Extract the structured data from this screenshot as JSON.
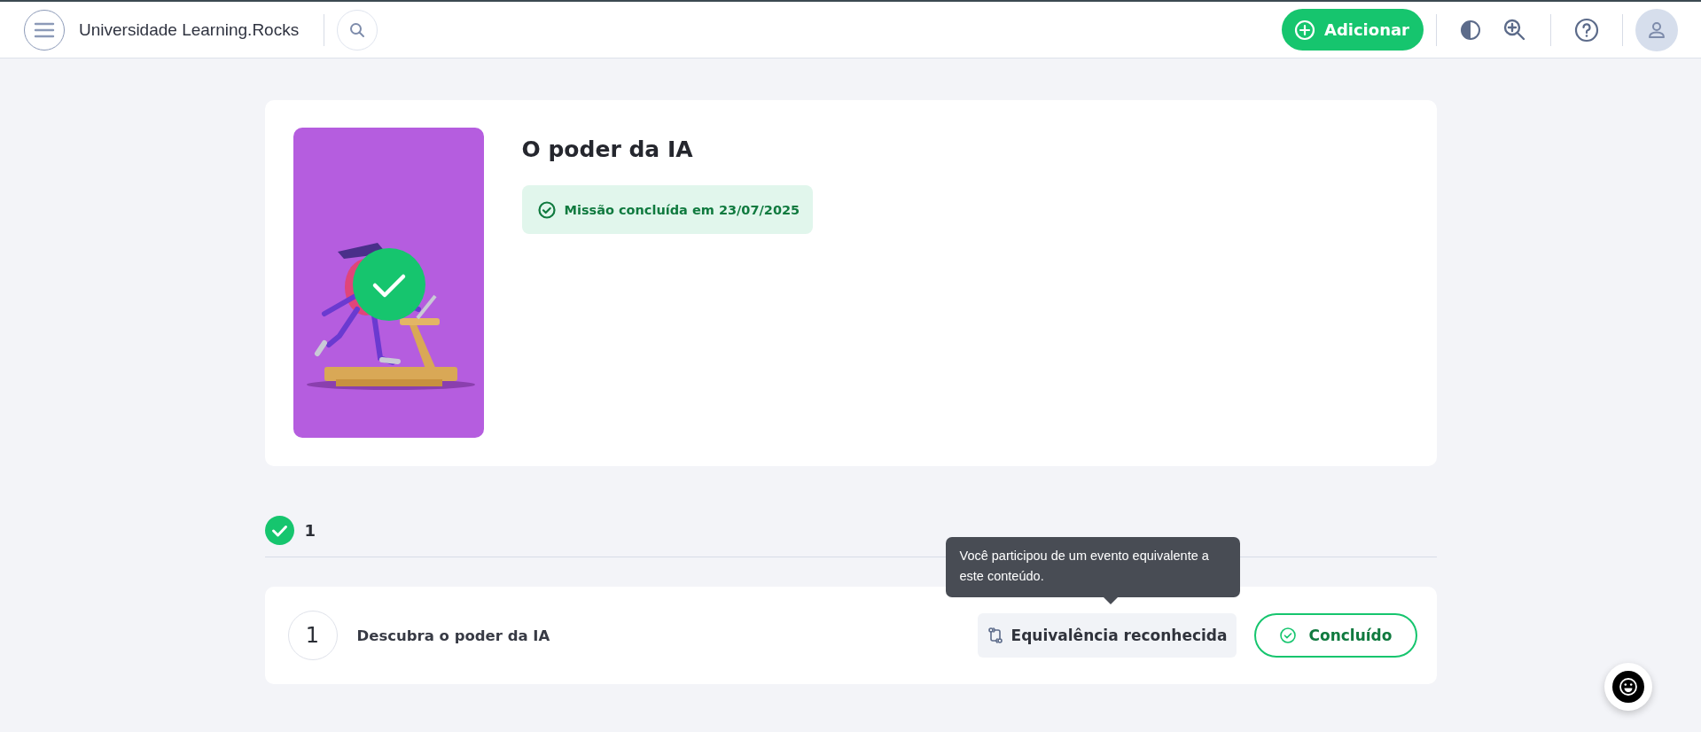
{
  "header": {
    "title": "Universidade Learning.Rocks",
    "add_button": "Adicionar"
  },
  "mission": {
    "title": "O poder da IA",
    "completed": true,
    "status": "Missão concluída em 23/07/2025"
  },
  "progress": {
    "completed_count": "1"
  },
  "steps": [
    {
      "number": "1",
      "title": "Descubra o poder da IA",
      "equivalence": "Equivalência reconhecida",
      "status": "Concluído",
      "completed": true
    }
  ],
  "tooltip": {
    "text": "Você participou de um evento equivalente a este conteúdo."
  }
}
